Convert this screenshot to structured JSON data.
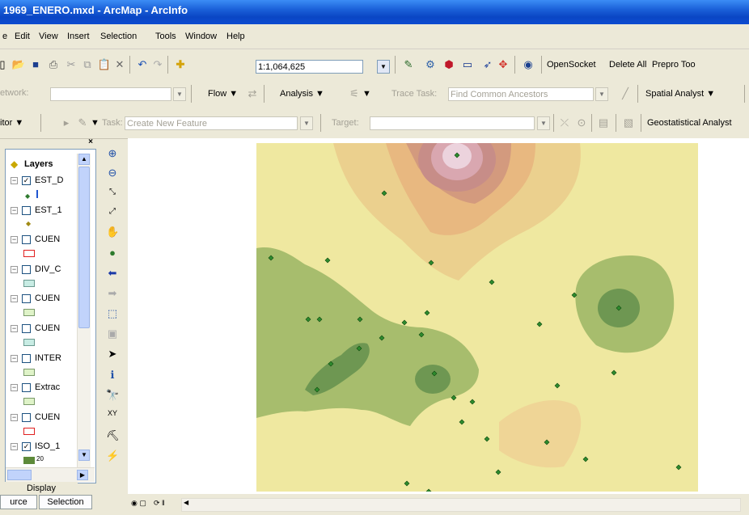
{
  "window": {
    "title": "1969_ENERO.mxd - ArcMap - ArcInfo"
  },
  "menubar": {
    "items": [
      "e",
      "Edit",
      "View",
      "Insert",
      "Selection",
      "Tools",
      "Window",
      "Help"
    ]
  },
  "standard_toolbar": {
    "scale": "1:1,064,625",
    "right_items": [
      "OpenSocket",
      "Delete All",
      "Prepro Too"
    ]
  },
  "network_toolbar": {
    "label": "etwork:",
    "flow": "Flow ▼",
    "analysis": "Analysis ▼",
    "trace_task_label": "Trace Task:",
    "trace_task_value": "Find Common Ancestors",
    "spatial_analyst": "Spatial Analyst ▼"
  },
  "editor_toolbar": {
    "editor": "itor ▼",
    "task_label": "Task:",
    "task_value": "Create New Feature",
    "target_label": "Target:",
    "geostatistical": "Geostatistical Analyst"
  },
  "toc": {
    "root": "Layers",
    "layers": [
      {
        "name": "EST_D",
        "checked": true,
        "symbol": "point-and-line"
      },
      {
        "name": "EST_1",
        "checked": false,
        "symbol": "point"
      },
      {
        "name": "CUEN",
        "checked": false,
        "symbol": "red-outline"
      },
      {
        "name": "DIV_C",
        "checked": false,
        "symbol": "teal-fill"
      },
      {
        "name": "CUEN",
        "checked": false,
        "symbol": "green-fill"
      },
      {
        "name": "CUEN",
        "checked": false,
        "symbol": "teal-fill"
      },
      {
        "name": "INTER",
        "checked": false,
        "symbol": "green-fill"
      },
      {
        "name": "Extrac",
        "checked": false,
        "symbol": "green-fill"
      },
      {
        "name": "CUEN",
        "checked": false,
        "symbol": "red-outline"
      },
      {
        "name": "ISO_1",
        "checked": true,
        "symbol": "ramp"
      }
    ],
    "partial_value": "20"
  },
  "bottom": {
    "display_tab": "Display",
    "source_tab": "urce",
    "selection_tab": "Selection"
  },
  "colors": {
    "title_bar": "#0a46c4",
    "map_light_yellow": "#efe8a0",
    "map_orange": "#ebc98a",
    "map_green": "#a6bc6c",
    "map_dark_green": "#6d9650"
  },
  "icons": [
    "zoom-in-icon",
    "zoom-out-icon",
    "fixed-zoom-in-icon",
    "fixed-zoom-out-icon",
    "pan-icon",
    "full-extent-icon",
    "back-extent-icon",
    "forward-extent-icon",
    "select-features-icon",
    "clear-selection-icon",
    "select-elements-icon",
    "identify-icon",
    "find-icon",
    "go-to-xy-icon",
    "measure-icon",
    "hyperlink-icon"
  ]
}
